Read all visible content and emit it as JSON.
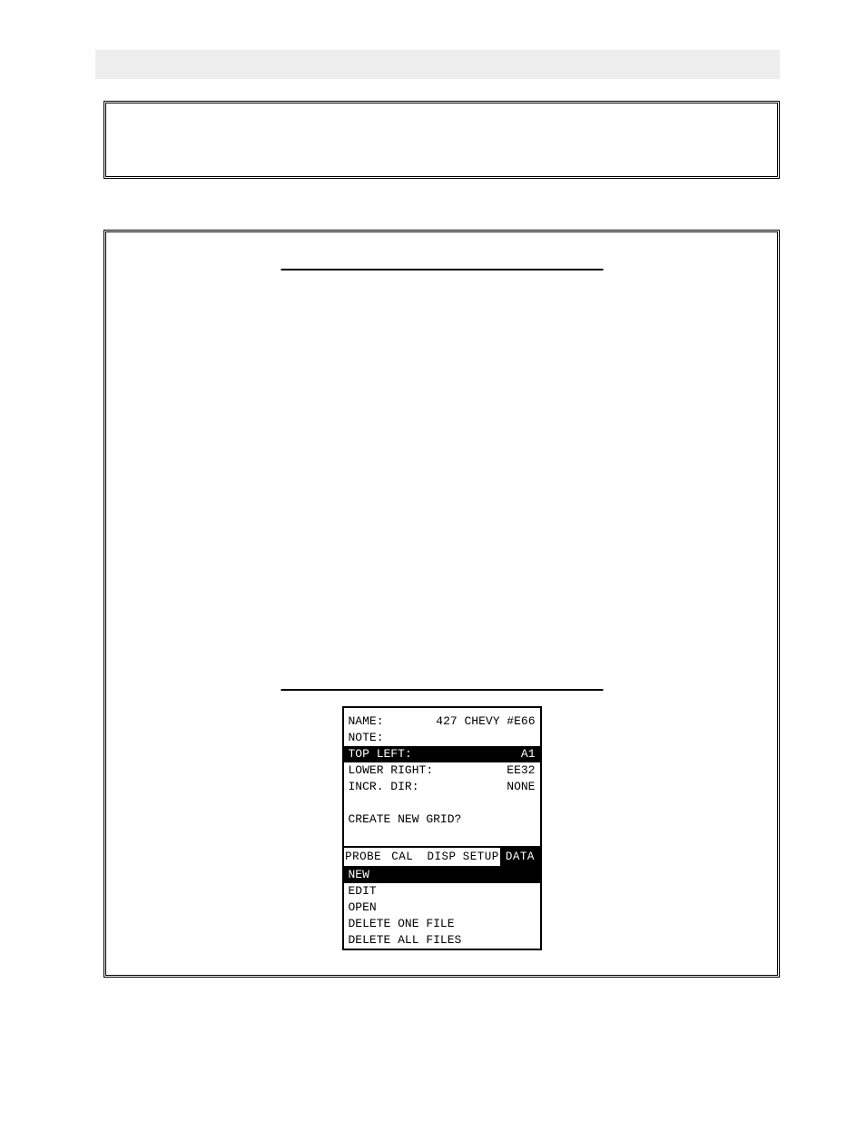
{
  "screen": {
    "fields": [
      {
        "label": "NAME:",
        "value": "427 CHEVY #E66",
        "selected": false
      },
      {
        "label": "NOTE:",
        "value": "",
        "selected": false
      },
      {
        "label": "TOP LEFT:",
        "value": "A1",
        "selected": true
      },
      {
        "label": "LOWER RIGHT:",
        "value": "EE32",
        "selected": false
      },
      {
        "label": "INCR. DIR:",
        "value": "NONE",
        "selected": false
      }
    ],
    "prompt": "CREATE NEW GRID?",
    "tabs": [
      {
        "label": "PROBE",
        "active": false
      },
      {
        "label": "CAL",
        "active": false
      },
      {
        "label": "DISP",
        "active": false
      },
      {
        "label": "SETUP",
        "active": false
      },
      {
        "label": "DATA",
        "active": true
      }
    ],
    "menu": [
      {
        "label": "NEW",
        "selected": true
      },
      {
        "label": "EDIT",
        "selected": false
      },
      {
        "label": "OPEN",
        "selected": false
      },
      {
        "label": "DELETE ONE FILE",
        "selected": false
      },
      {
        "label": "DELETE ALL FILES",
        "selected": false
      }
    ]
  }
}
